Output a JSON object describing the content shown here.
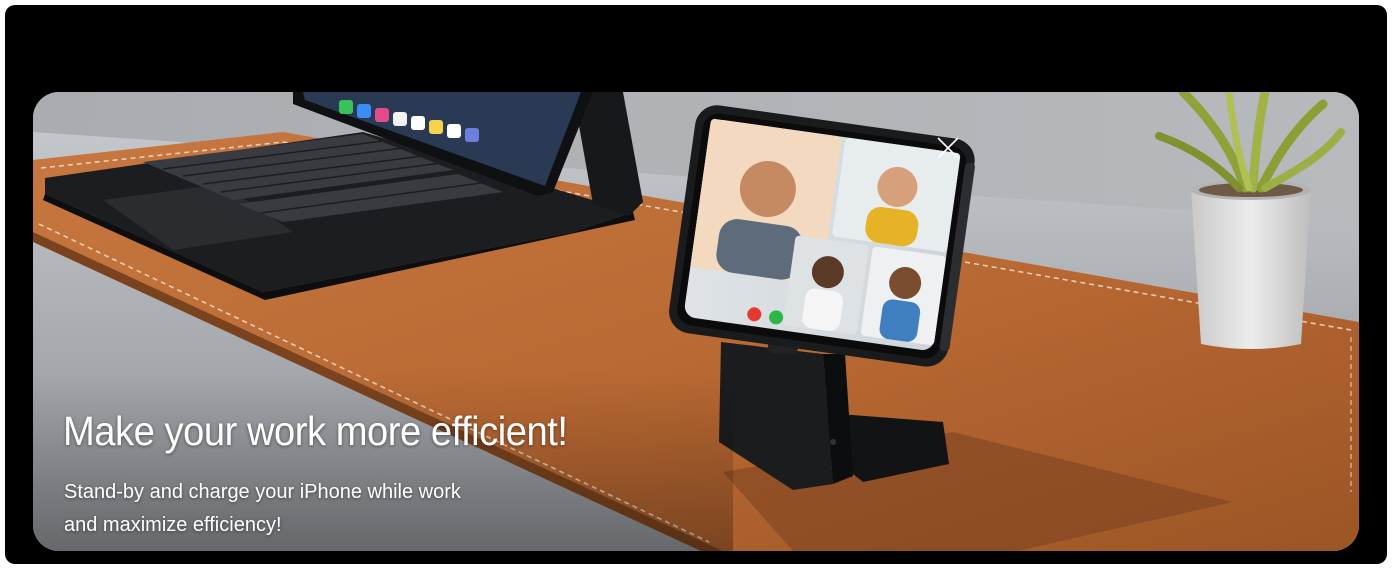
{
  "banner": {
    "headline": "Make your work more efficient!",
    "subline_line1": "Stand-by and charge your iPhone while work",
    "subline_line2": "and maximize efficiency!"
  },
  "colors": {
    "frame": "#000000",
    "desk": "#a7aaae",
    "leather_mat": "#b96a36",
    "stitching": "#e9d8c4",
    "keyboard": "#1e1f22",
    "stand": "#1b1c1e",
    "plant_leaves": "#8fa23a",
    "pot": "#d8d8d8",
    "decline_call": "#e5392f",
    "accept_call": "#2fb548",
    "text": "#ffffff"
  },
  "icons": {
    "decline_call": "phone-decline-icon",
    "accept_call": "phone-accept-icon"
  }
}
